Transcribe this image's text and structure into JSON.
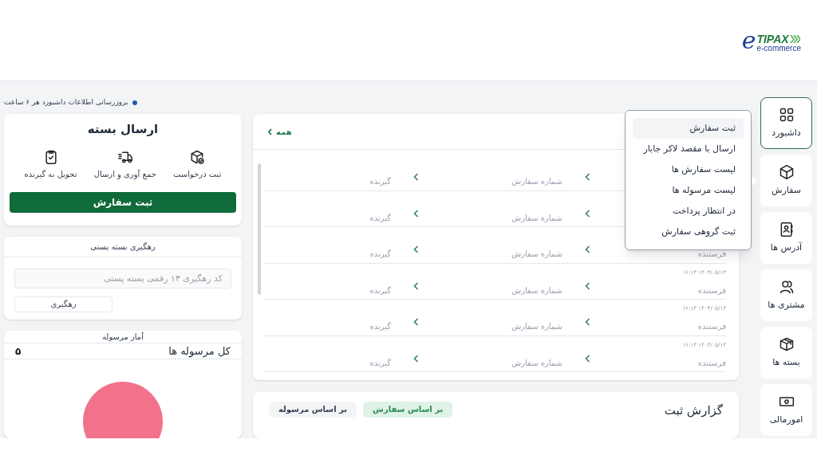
{
  "logo": {
    "letter": "e",
    "brand": "TIPAX",
    "tagline": "e-commerce"
  },
  "sidebar": {
    "items": [
      {
        "label": "داشبورد",
        "selected": true
      },
      {
        "label": "سفارش",
        "selected": false
      },
      {
        "label": "آدرس ها",
        "selected": false
      },
      {
        "label": "مشتری ها",
        "selected": false
      },
      {
        "label": "بسته ها",
        "selected": false
      },
      {
        "label": "امورمالی",
        "selected": false
      }
    ]
  },
  "dropdown_menu": {
    "items": [
      {
        "label": "ثبت سفارش",
        "selected": true
      },
      {
        "label": "ارسال با مقصد لاکر جابار",
        "selected": false
      },
      {
        "label": "لیست سفارش ها",
        "selected": false
      },
      {
        "label": "لیست مرسوله ها",
        "selected": false
      },
      {
        "label": "در انتظار پرداخت",
        "selected": false
      },
      {
        "label": "ثبت گروهی سفارش",
        "selected": false
      }
    ]
  },
  "orders_panel": {
    "all_link": "همه",
    "rows": [
      {
        "order": "شماره سفارش",
        "receiver": "گیرنده"
      },
      {
        "order": "شماره سفارش",
        "receiver": "گیرنده"
      },
      {
        "sender": "فرستنده",
        "order": "شماره سفارش",
        "receiver": "گیرنده"
      },
      {
        "date": "۱۶:۱۳ ۱۴۰۳/۰۵/۱۳",
        "sender": "فرستنده",
        "order": "شماره سفارش",
        "receiver": "گیرنده"
      },
      {
        "date": "۱۶:۱۳ ۱۴۰۳/۰۵/۱۳",
        "sender": "فرستنده",
        "order": "شماره سفارش",
        "receiver": "گیرنده"
      },
      {
        "date": "۱۶:۱۳ ۱۴۰۳/۰۵/۱۳",
        "sender": "فرستنده",
        "order": "شماره سفارش",
        "receiver": "گیرنده"
      }
    ]
  },
  "report": {
    "title": "گزارش ثبت",
    "filters": [
      {
        "label": "بر اساس سفارش",
        "selected": true
      },
      {
        "label": "بر اساس مرسوله",
        "selected": false
      }
    ]
  },
  "update_notice": "بروزرسانی اطلاعات داشبورد هر ۶ ساعت",
  "send_parcel": {
    "title": "ارسال بسته",
    "steps": [
      {
        "label": "ثبت درخواست"
      },
      {
        "label": "جمع آوری و ارسال"
      },
      {
        "label": "تحویل به گیرنده"
      }
    ],
    "button": "ثبت سفارش"
  },
  "tracking": {
    "title": "رهگیری بسته پستی",
    "placeholder": "کد رهگیری ۱۳ رقمی بسته پستی",
    "button": "رهگیری"
  },
  "stats": {
    "title": "آمار مرسوله",
    "total_label": "کل مرسوله ها",
    "total_value": "۵"
  }
}
